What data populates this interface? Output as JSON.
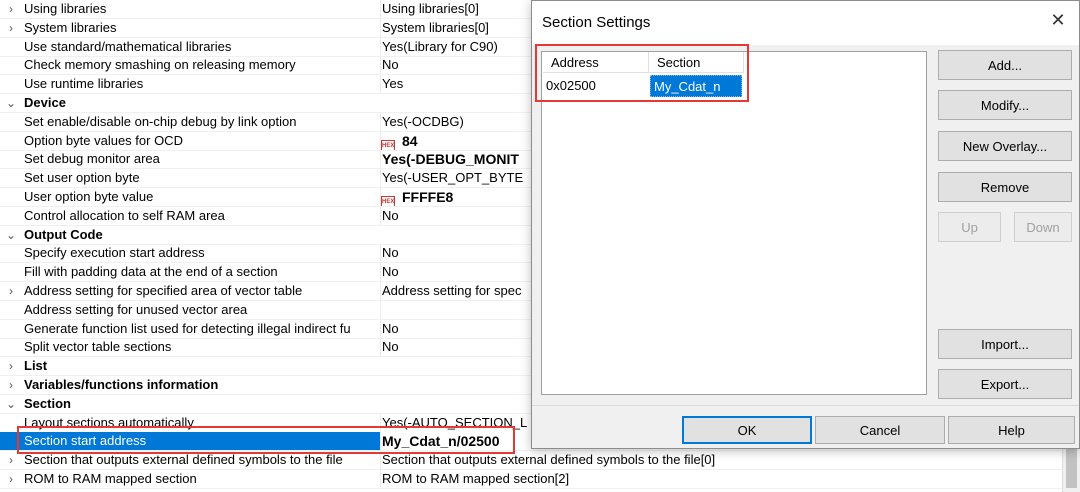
{
  "grid": {
    "rows": [
      {
        "exp": "›",
        "name": "Using libraries",
        "value": "Using libraries[0]"
      },
      {
        "exp": "›",
        "name": "System libraries",
        "value": "System libraries[0]"
      },
      {
        "exp": "",
        "name": "Use standard/mathematical libraries",
        "value": "Yes(Library for C90)"
      },
      {
        "exp": "",
        "name": "Check memory smashing on releasing memory",
        "value": "No"
      },
      {
        "exp": "",
        "name": "Use runtime libraries",
        "value": "Yes"
      },
      {
        "exp": "⌄",
        "name": "Device",
        "value": "",
        "cat": true
      },
      {
        "exp": "",
        "name": "Set enable/disable on-chip debug by link option",
        "value": "Yes(-OCDBG)"
      },
      {
        "exp": "",
        "name": "Option byte values for OCD",
        "value": "84",
        "hex": true
      },
      {
        "exp": "",
        "name": "Set debug monitor area",
        "value": "Yes(-DEBUG_MONIT",
        "bold": true
      },
      {
        "exp": "",
        "name": "Set user option byte",
        "value": "Yes(-USER_OPT_BYTE"
      },
      {
        "exp": "",
        "name": "User option byte value",
        "value": "FFFFE8",
        "hex": true
      },
      {
        "exp": "",
        "name": "Control allocation to self RAM area",
        "value": "No"
      },
      {
        "exp": "⌄",
        "name": "Output Code",
        "value": "",
        "cat": true
      },
      {
        "exp": "",
        "name": "Specify execution start address",
        "value": "No"
      },
      {
        "exp": "",
        "name": "Fill with padding data at the end of a section",
        "value": "No"
      },
      {
        "exp": "›",
        "name": "Address setting for specified area of vector table",
        "value": "Address setting for spec"
      },
      {
        "exp": "",
        "name": "Address setting for unused vector area",
        "value": ""
      },
      {
        "exp": "",
        "name": "Generate function list used for detecting illegal indirect fu",
        "value": "No"
      },
      {
        "exp": "",
        "name": "Split vector table sections",
        "value": "No"
      },
      {
        "exp": "›",
        "name": "List",
        "value": "",
        "cat": true
      },
      {
        "exp": "›",
        "name": "Variables/functions information",
        "value": "",
        "cat": true
      },
      {
        "exp": "⌄",
        "name": "Section",
        "value": "",
        "cat": true
      },
      {
        "exp": "",
        "name": "Layout sections automatically",
        "value": "Yes(-AUTO_SECTION_L"
      },
      {
        "exp": "",
        "name": "Section start address",
        "value": "My_Cdat_n/02500",
        "sel": true
      },
      {
        "exp": "›",
        "name": "Section that outputs external defined symbols to the file",
        "value": "Section that outputs external defined symbols to the file[0]"
      },
      {
        "exp": "›",
        "name": "ROM to RAM mapped section",
        "value": "ROM to RAM mapped section[2]"
      }
    ],
    "hex_icon_label": "HEX"
  },
  "dialog": {
    "title": "Section Settings",
    "close": "✕",
    "columns": {
      "address": "Address",
      "section": "Section"
    },
    "entry": {
      "address": "0x02500",
      "section": "My_Cdat_n"
    },
    "buttons": {
      "add": "Add...",
      "modify": "Modify...",
      "new_overlay": "New Overlay...",
      "remove": "Remove",
      "up": "Up",
      "down": "Down",
      "import": "Import...",
      "export": "Export...",
      "ok": "OK",
      "cancel": "Cancel",
      "help": "Help"
    }
  },
  "colors": {
    "selection": "#0078d7",
    "highlight_box": "#e53935"
  }
}
